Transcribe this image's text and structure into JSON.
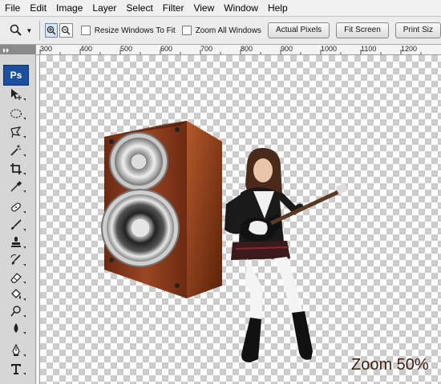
{
  "menu": [
    "File",
    "Edit",
    "Image",
    "Layer",
    "Select",
    "Filter",
    "View",
    "Window",
    "Help"
  ],
  "options": {
    "tool_icon": "zoom-icon",
    "resize_windows_label": "Resize Windows To Fit",
    "zoom_all_label": "Zoom All Windows",
    "actual_pixels_label": "Actual Pixels",
    "fit_screen_label": "Fit Screen",
    "print_size_label": "Print Siz"
  },
  "ruler": {
    "labels": [
      "300",
      "400",
      "500",
      "600",
      "700",
      "800",
      "900",
      "1000",
      "1100",
      "1200"
    ]
  },
  "toolbox": {
    "logo": "Ps",
    "tools": [
      "move-icon",
      "elliptical-marquee-icon",
      "polygonal-lasso-icon",
      "magic-wand-icon",
      "crop-icon",
      "eyedropper-icon",
      "healing-brush-icon",
      "brush-icon",
      "clone-stamp-icon",
      "history-brush-icon",
      "eraser-icon",
      "paint-bucket-icon",
      "dodge-icon",
      "blur-icon",
      "pen-icon",
      "type-icon"
    ]
  },
  "canvas": {
    "images": [
      "speaker",
      "guitarist"
    ],
    "zoom_caption": "Zoom 50%"
  },
  "colors": {
    "caption": "#3e1f10",
    "speaker_wood": "#8a3a1b",
    "ps_logo": "#1d4f9f"
  }
}
